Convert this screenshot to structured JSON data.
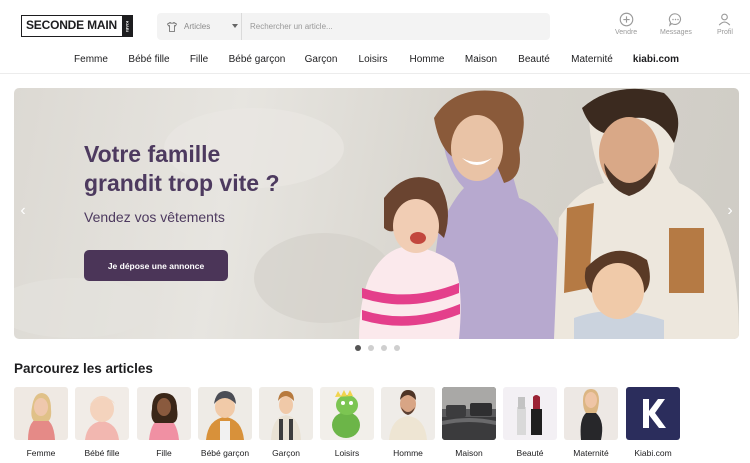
{
  "header": {
    "logo": {
      "text": "SECONDE MAIN",
      "tag": "KIABI"
    },
    "search": {
      "category": "Articles",
      "placeholder": "Rechercher un article..."
    },
    "actions": [
      {
        "label": "Vendre",
        "icon": "plus-circle-icon"
      },
      {
        "label": "Messages",
        "icon": "chat-bubble-icon"
      },
      {
        "label": "Profil",
        "icon": "user-icon"
      }
    ]
  },
  "nav": [
    "Femme",
    "Bébé fille",
    "Fille",
    "Bébé garçon",
    "Garçon",
    "Loisirs",
    "Homme",
    "Maison",
    "Beauté",
    "Maternité",
    "kiabi.com"
  ],
  "hero": {
    "title_line1": "Votre famille",
    "title_line2": "grandit trop vite ?",
    "subtitle": "Vendez vos vêtements",
    "cta": "Je dépose une annonce",
    "slides": 4,
    "active_slide": 1,
    "colors": {
      "title": "#4d3a5f",
      "button": "#4b3558"
    }
  },
  "categories": {
    "title": "Parcourez les articles",
    "items": [
      {
        "label": "Femme",
        "icon": "woman-photo"
      },
      {
        "label": "Bébé fille",
        "icon": "baby-girl-photo"
      },
      {
        "label": "Fille",
        "icon": "girl-photo"
      },
      {
        "label": "Bébé garçon",
        "icon": "baby-boy-photo"
      },
      {
        "label": "Garçon",
        "icon": "boy-photo"
      },
      {
        "label": "Loisirs",
        "icon": "plush-dino-photo"
      },
      {
        "label": "Homme",
        "icon": "man-photo"
      },
      {
        "label": "Maison",
        "icon": "bed-photo"
      },
      {
        "label": "Beauté",
        "icon": "lipstick-photo"
      },
      {
        "label": "Maternité",
        "icon": "pregnant-woman-photo"
      },
      {
        "label": "Kiabi.com",
        "icon": "kiabi-logo"
      }
    ]
  }
}
